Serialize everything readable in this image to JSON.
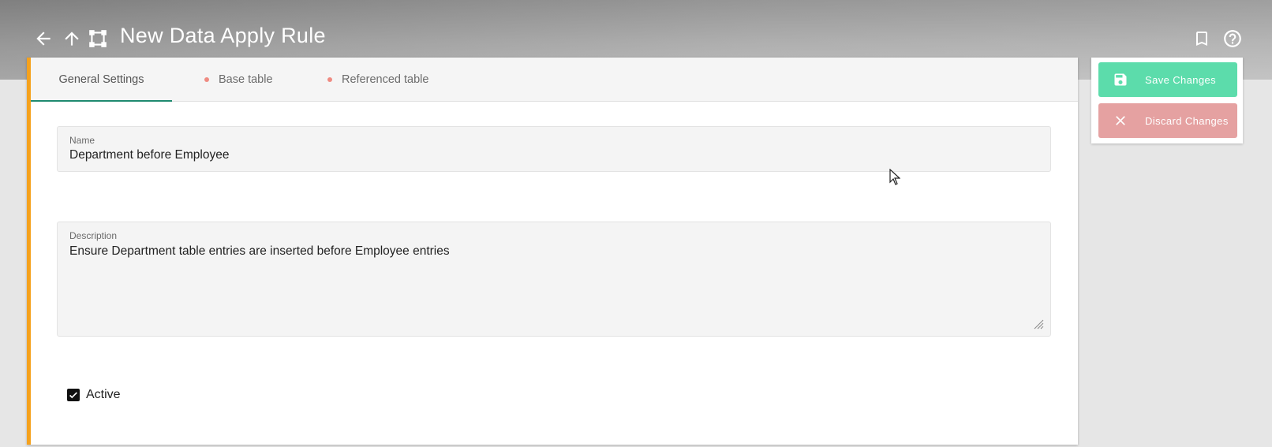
{
  "header": {
    "title": "New Data Apply Rule",
    "back_icon": "arrow-left-icon",
    "up_icon": "arrow-up-icon",
    "entity_icon": "rule-shape-icon",
    "bookmark_icon": "bookmark-icon",
    "help_icon": "help-circle-icon"
  },
  "tabs": [
    {
      "label": "General Settings",
      "active": true,
      "dot": false
    },
    {
      "label": "Base table",
      "active": false,
      "dot": true
    },
    {
      "label": "Referenced table",
      "active": false,
      "dot": true
    }
  ],
  "form": {
    "name": {
      "label": "Name",
      "value": "Department before Employee"
    },
    "description": {
      "label": "Description",
      "value": "Ensure Department table entries are inserted before Employee entries"
    },
    "active": {
      "label": "Active",
      "checked": true
    }
  },
  "actions": {
    "save_label": "Save Changes",
    "discard_label": "Discard Changes",
    "save_icon": "floppy-disk-icon",
    "discard_icon": "close-icon"
  },
  "colors": {
    "accent": "#f5a11c",
    "tab_underline": "#1f8a70",
    "save_button": "#5cdcab",
    "discard_button": "#e5a1a1",
    "tab_dot": "#ef8b82"
  }
}
